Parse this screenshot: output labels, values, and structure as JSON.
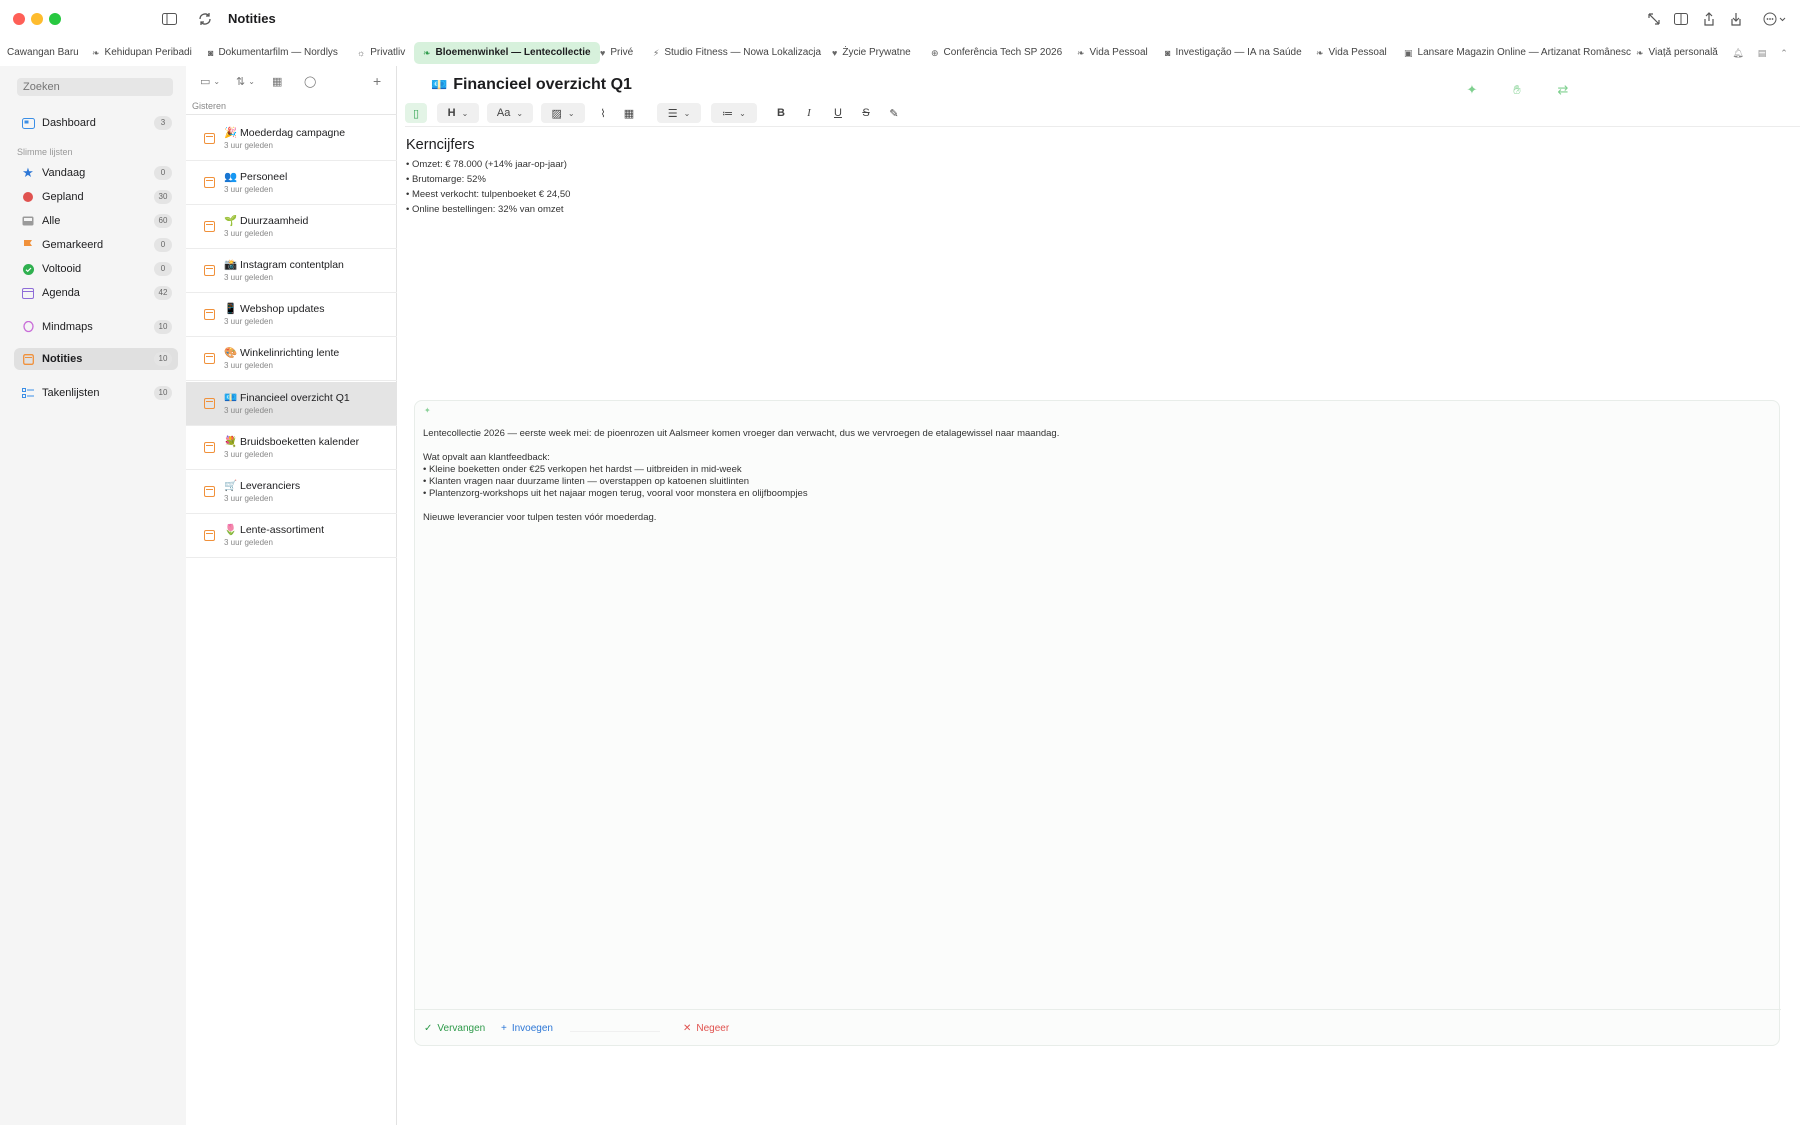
{
  "app": {
    "title": "Notities"
  },
  "tabs": [
    {
      "label": "Cawangan Baru",
      "icon": "leaf-icon"
    },
    {
      "label": "Kehidupan Peribadi",
      "icon": "leaf-icon"
    },
    {
      "label": "Dokumentarfilm — Nordlys",
      "icon": "camera-icon"
    },
    {
      "label": "Privatliv",
      "icon": "sun-icon"
    },
    {
      "label": "Bloemenwinkel — Lentecollectie",
      "icon": "leaf-icon",
      "active": true
    },
    {
      "label": "Privé",
      "icon": "heart-icon"
    },
    {
      "label": "Studio Fitness — Nowa Lokalizacja",
      "icon": "runner-icon"
    },
    {
      "label": "Życie Prywatne",
      "icon": "heart-icon"
    },
    {
      "label": "Conferência Tech SP 2026",
      "icon": "globe-icon"
    },
    {
      "label": "Vida Pessoal",
      "icon": "leaf-icon"
    },
    {
      "label": "Investigação — IA na Saúde",
      "icon": "camera-icon"
    },
    {
      "label": "Vida Pessoal",
      "icon": "leaf-icon"
    },
    {
      "label": "Lansare Magazin Online — Artizanat Românesc",
      "icon": "bag-icon"
    },
    {
      "label": "Viață personală",
      "icon": "leaf-icon"
    }
  ],
  "sidebar": {
    "search_placeholder": "Zoeken",
    "smart_header": "Slimme lijsten",
    "items": [
      {
        "label": "Dashboard",
        "count": "3",
        "icon": "dashboard-icon",
        "color": "#3a8ee6"
      },
      {
        "label": "Vandaag",
        "count": "0",
        "icon": "star-icon",
        "color": "#2d77d6"
      },
      {
        "label": "Gepland",
        "count": "30",
        "icon": "clock-icon",
        "color": "#e0524f"
      },
      {
        "label": "Alle",
        "count": "60",
        "icon": "tray-icon",
        "color": "#8a8a8a"
      },
      {
        "label": "Gemarkeerd",
        "count": "0",
        "icon": "flag-icon",
        "color": "#f0913b"
      },
      {
        "label": "Voltooid",
        "count": "0",
        "icon": "check-circle-icon",
        "color": "#2fb04f"
      },
      {
        "label": "Agenda",
        "count": "42",
        "icon": "calendar-icon",
        "color": "#8e6cd8"
      },
      {
        "label": "Mindmaps",
        "count": "10",
        "icon": "mindmap-icon",
        "color": "#c86cd8"
      },
      {
        "label": "Notities",
        "count": "10",
        "icon": "note-icon",
        "color": "#f0913b",
        "selected": true
      },
      {
        "label": "Takenlijsten",
        "count": "10",
        "icon": "checklist-icon",
        "color": "#3a8ee6"
      }
    ]
  },
  "notelist": {
    "section": "Gisteren",
    "items": [
      {
        "emoji": "🎉",
        "title": "Moederdag campagne",
        "sub": "3 uur geleden"
      },
      {
        "emoji": "👥",
        "title": "Personeel",
        "sub": "3 uur geleden"
      },
      {
        "emoji": "🌱",
        "title": "Duurzaamheid",
        "sub": "3 uur geleden"
      },
      {
        "emoji": "📸",
        "title": "Instagram contentplan",
        "sub": "3 uur geleden"
      },
      {
        "emoji": "📱",
        "title": "Webshop updates",
        "sub": "3 uur geleden"
      },
      {
        "emoji": "🎨",
        "title": "Winkelinrichting lente",
        "sub": "3 uur geleden"
      },
      {
        "emoji": "💶",
        "title": "Financieel overzicht Q1",
        "sub": "3 uur geleden",
        "selected": true
      },
      {
        "emoji": "💐",
        "title": "Bruidsboeketten kalender",
        "sub": "3 uur geleden"
      },
      {
        "emoji": "🛒",
        "title": "Leveranciers",
        "sub": "3 uur geleden"
      },
      {
        "emoji": "🌷",
        "title": "Lente-assortiment",
        "sub": "3 uur geleden"
      }
    ]
  },
  "editor": {
    "title_emoji": "💶",
    "title": "Financieel overzicht Q1",
    "toolbar": {
      "heading": "H",
      "font": "Aa",
      "bold": "B",
      "italic": "I",
      "underline": "U",
      "strike": "S"
    },
    "heading": "Kerncijfers",
    "lines": [
      "• Omzet: € 78.000 (+14% jaar-op-jaar)",
      "• Brutomarge: 52%",
      "• Meest verkocht: tulpenboeket € 24,50",
      "• Online bestellingen: 32% van omzet"
    ]
  },
  "ai_panel": {
    "paragraphs": [
      "Lentecollectie 2026 — eerste week mei: de pioenrozen uit Aalsmeer komen vroeger dan verwacht, dus we vervroegen de etalagewissel naar maandag.",
      "",
      "Wat opvalt aan klantfeedback:",
      "• Kleine boeketten onder €25 verkopen het hardst — uitbreiden in mid-week",
      "• Klanten vragen naar duurzame linten — overstappen op katoenen sluitlinten",
      "• Plantenzorg-workshops uit het najaar mogen terug, vooral voor monstera en olijfboompjes",
      "",
      "Nieuwe leverancier voor tulpen testen vóór moederdag."
    ],
    "replace": "Vervangen",
    "insert": "Invoegen",
    "ignore": "Negeer"
  }
}
